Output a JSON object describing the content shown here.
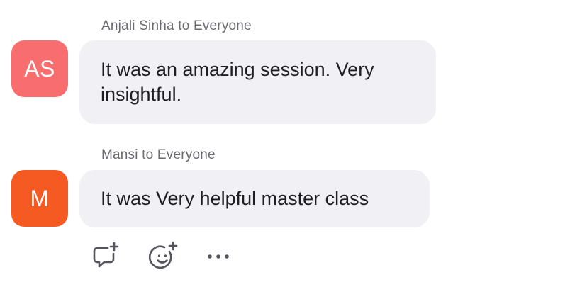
{
  "messages": [
    {
      "sender_line": "Anjali Sinha to Everyone",
      "avatar_initials": "AS",
      "avatar_color": "#f86d6d",
      "text": "It was an amazing session. Very insightful."
    },
    {
      "sender_line": "Mansi to Everyone",
      "avatar_initials": "M",
      "avatar_color": "#f55a22",
      "text": "It was Very helpful master class"
    }
  ],
  "actions": [
    {
      "icon": "reply-icon"
    },
    {
      "icon": "add-reaction-icon"
    },
    {
      "icon": "more-icon"
    }
  ],
  "colors": {
    "bubble_bg": "#f0f0f5",
    "icon_color": "#54545c"
  }
}
